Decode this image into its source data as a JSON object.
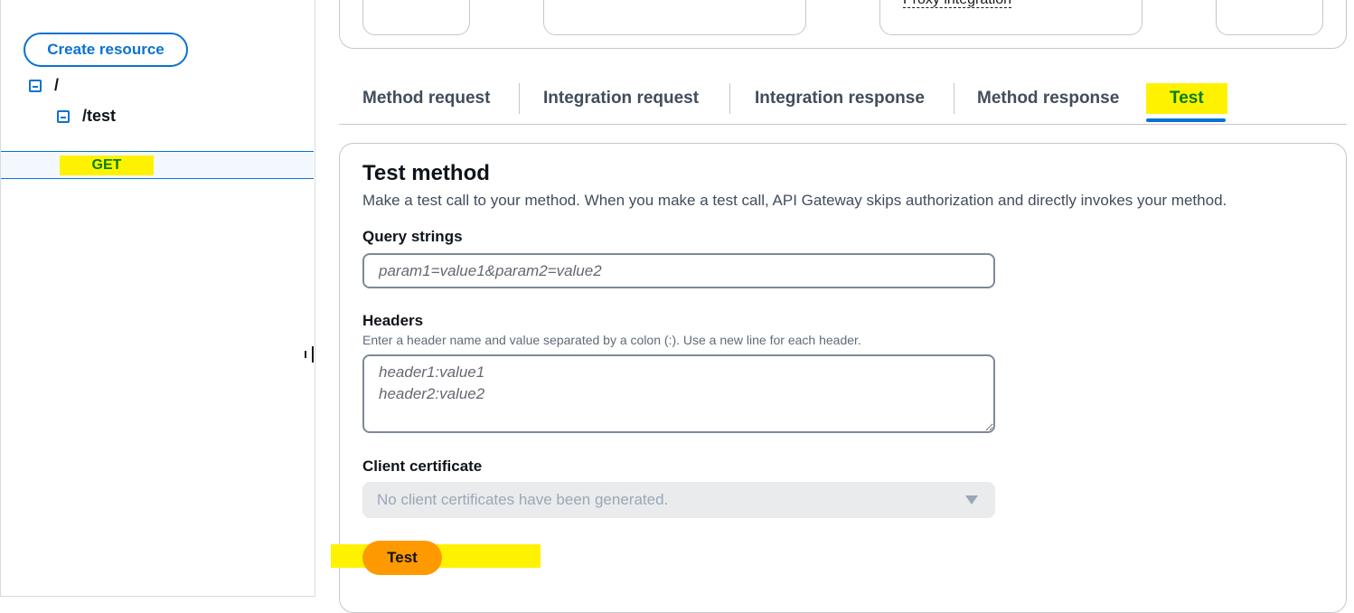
{
  "sidebar": {
    "create_button": "Create resource",
    "tree": [
      {
        "label": "/"
      },
      {
        "label": "/test"
      },
      {
        "label": "GET"
      }
    ]
  },
  "top_card": {
    "proxy_integration_label": "Proxy integration"
  },
  "tabs": [
    {
      "label": "Method request"
    },
    {
      "label": "Integration request"
    },
    {
      "label": "Integration response"
    },
    {
      "label": "Method response"
    },
    {
      "label": "Test",
      "active": true
    }
  ],
  "test_method": {
    "title": "Test method",
    "description": "Make a test call to your method. When you make a test call, API Gateway skips authorization and directly invokes your method.",
    "query_strings": {
      "label": "Query strings",
      "placeholder": "param1=value1&param2=value2"
    },
    "headers": {
      "label": "Headers",
      "hint": "Enter a header name and value separated by a colon (:). Use a new line for each header.",
      "placeholder": "header1:value1\nheader2:value2"
    },
    "client_certificate": {
      "label": "Client certificate",
      "selected": "No client certificates have been generated."
    },
    "test_button": "Test"
  },
  "colors": {
    "accent": "#0972d3",
    "highlight": "#fff200",
    "primary_button": "#ff9900",
    "method_green": "#037f0c"
  }
}
